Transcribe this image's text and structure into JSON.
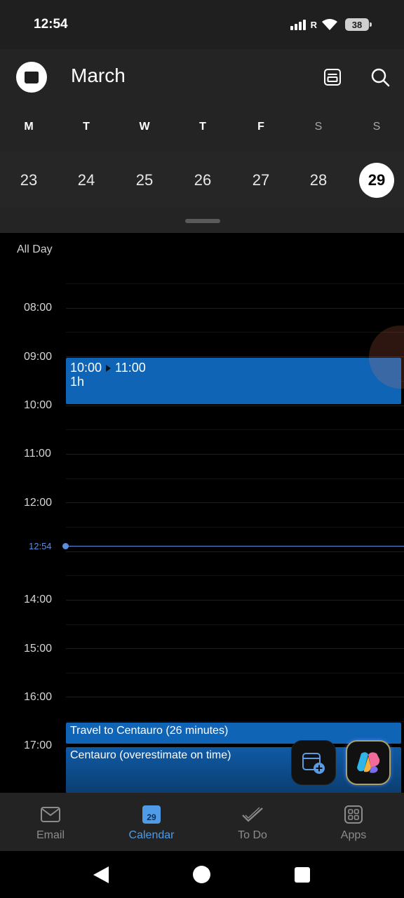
{
  "status_bar": {
    "time": "12:54",
    "roaming": "R",
    "battery": "38"
  },
  "header": {
    "month": "March",
    "weekdays": [
      "M",
      "T",
      "W",
      "T",
      "F",
      "S",
      "S"
    ],
    "dates": [
      "23",
      "24",
      "25",
      "26",
      "27",
      "28",
      "29"
    ],
    "selected_date": "29",
    "icons": {
      "app": "calendar-app-icon",
      "view": "day-view-icon",
      "search": "search-icon"
    }
  },
  "timeline": {
    "all_day_label": "All Day",
    "hours": [
      "08:00",
      "09:00",
      "10:00",
      "11:00",
      "12:00",
      "14:00",
      "15:00",
      "16:00",
      "17:00"
    ],
    "now_label": "12:54",
    "events": [
      {
        "start": "10:00",
        "end": "11:00",
        "duration": "1h"
      },
      {
        "title": "Travel to Centauro (26 minutes)"
      },
      {
        "title": "Centauro (overestimate on time)"
      }
    ]
  },
  "fabs": {
    "new_event": "new-event-icon",
    "copilot": "copilot-icon"
  },
  "bottom_nav": {
    "items": [
      {
        "label": "Email",
        "icon": "mail-icon"
      },
      {
        "label": "Calendar",
        "icon": "calendar-icon",
        "badge": "29",
        "active": true
      },
      {
        "label": "To Do",
        "icon": "checkmark-icon"
      },
      {
        "label": "Apps",
        "icon": "apps-grid-icon"
      }
    ]
  },
  "colors": {
    "accent": "#4f9be8",
    "event": "#0f64b6",
    "now": "#5b8fdd",
    "background": "#000000"
  }
}
